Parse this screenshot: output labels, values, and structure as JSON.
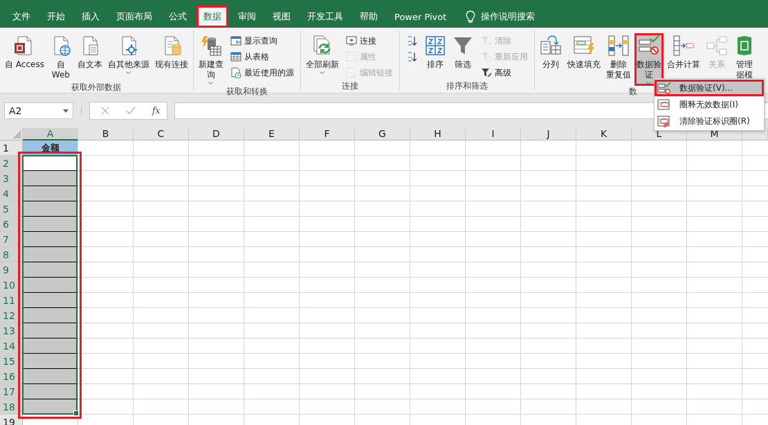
{
  "tabs": [
    {
      "label": "文件",
      "selected": false,
      "highlighted": false
    },
    {
      "label": "开始",
      "selected": false,
      "highlighted": false
    },
    {
      "label": "插入",
      "selected": false,
      "highlighted": false
    },
    {
      "label": "页面布局",
      "selected": false,
      "highlighted": false
    },
    {
      "label": "公式",
      "selected": false,
      "highlighted": false
    },
    {
      "label": "数据",
      "selected": true,
      "highlighted": true
    },
    {
      "label": "审阅",
      "selected": false,
      "highlighted": false
    },
    {
      "label": "视图",
      "selected": false,
      "highlighted": false
    },
    {
      "label": "开发工具",
      "selected": false,
      "highlighted": false
    },
    {
      "label": "帮助",
      "selected": false,
      "highlighted": false
    },
    {
      "label": "Power Pivot",
      "selected": false,
      "highlighted": false
    }
  ],
  "tell_me": "操作说明搜索",
  "ribbon": [
    {
      "label": "获取外部数据",
      "buttons": [
        {
          "kind": "large",
          "lines": [
            "自 Access"
          ],
          "disabled": false,
          "menu": false,
          "pressed": false,
          "highlighted": false
        },
        {
          "kind": "large",
          "lines": [
            "自",
            "Web"
          ],
          "disabled": false,
          "menu": false,
          "pressed": false,
          "highlighted": false
        },
        {
          "kind": "large",
          "lines": [
            "自文本"
          ],
          "disabled": false,
          "menu": false,
          "pressed": false,
          "highlighted": false
        },
        {
          "kind": "large",
          "lines": [
            "自其他来源"
          ],
          "disabled": false,
          "menu": true,
          "pressed": false,
          "highlighted": false
        },
        {
          "kind": "large",
          "lines": [
            "现有连接"
          ],
          "disabled": false,
          "menu": false,
          "pressed": false,
          "highlighted": false
        }
      ]
    },
    {
      "label": "获取和转换",
      "buttons": [
        {
          "kind": "large",
          "lines": [
            "新建查",
            "询"
          ],
          "disabled": false,
          "menu": true,
          "pressed": false,
          "highlighted": false
        },
        {
          "kind": "small",
          "lines": [
            "显示查询"
          ],
          "disabled": false,
          "menu": false,
          "pressed": false,
          "highlighted": false
        },
        {
          "kind": "small",
          "lines": [
            "从表格"
          ],
          "disabled": false,
          "menu": false,
          "pressed": false,
          "highlighted": false
        },
        {
          "kind": "small",
          "lines": [
            "最近使用的源"
          ],
          "disabled": false,
          "menu": false,
          "pressed": false,
          "highlighted": false
        }
      ]
    },
    {
      "label": "连接",
      "buttons": [
        {
          "kind": "large",
          "lines": [
            "全部刷新"
          ],
          "disabled": false,
          "menu": true,
          "pressed": false,
          "highlighted": false
        },
        {
          "kind": "small",
          "lines": [
            "连接"
          ],
          "disabled": false,
          "menu": false,
          "pressed": false,
          "highlighted": false
        },
        {
          "kind": "small",
          "lines": [
            "属性"
          ],
          "disabled": true,
          "menu": false,
          "pressed": false,
          "highlighted": false
        },
        {
          "kind": "small",
          "lines": [
            "编辑链接"
          ],
          "disabled": true,
          "menu": false,
          "pressed": false,
          "highlighted": false
        }
      ]
    },
    {
      "label": "排序和筛选",
      "buttons": [
        {
          "kind": "icon",
          "disabled": false,
          "menu": false,
          "pressed": false,
          "highlighted": false
        },
        {
          "kind": "icon",
          "disabled": false,
          "menu": false,
          "pressed": false,
          "highlighted": false
        },
        {
          "kind": "large",
          "lines": [
            "排序"
          ],
          "disabled": false,
          "menu": false,
          "pressed": false,
          "highlighted": false
        },
        {
          "kind": "large",
          "lines": [
            "筛选"
          ],
          "disabled": false,
          "menu": false,
          "pressed": false,
          "highlighted": false
        },
        {
          "kind": "small",
          "lines": [
            "清除"
          ],
          "disabled": true,
          "menu": false,
          "pressed": false,
          "highlighted": false
        },
        {
          "kind": "small",
          "lines": [
            "重新应用"
          ],
          "disabled": true,
          "menu": false,
          "pressed": false,
          "highlighted": false
        },
        {
          "kind": "small",
          "lines": [
            "高级"
          ],
          "disabled": false,
          "menu": false,
          "pressed": false,
          "highlighted": false
        }
      ]
    },
    {
      "label": "数",
      "buttons": [
        {
          "kind": "large",
          "lines": [
            "分列"
          ],
          "disabled": false,
          "menu": false,
          "pressed": false,
          "highlighted": false
        },
        {
          "kind": "large",
          "lines": [
            "快速填充"
          ],
          "disabled": false,
          "menu": false,
          "pressed": false,
          "highlighted": false
        },
        {
          "kind": "large",
          "lines": [
            "删除",
            "重复值"
          ],
          "disabled": false,
          "menu": false,
          "pressed": false,
          "highlighted": false
        },
        {
          "kind": "large",
          "lines": [
            "数据验",
            "证"
          ],
          "disabled": false,
          "menu": true,
          "pressed": true,
          "highlighted": true
        },
        {
          "kind": "large",
          "lines": [
            "合并计算"
          ],
          "disabled": false,
          "menu": false,
          "pressed": false,
          "highlighted": false
        },
        {
          "kind": "large",
          "lines": [
            "关系"
          ],
          "disabled": true,
          "menu": false,
          "pressed": false,
          "highlighted": false
        },
        {
          "kind": "large",
          "lines": [
            "管理",
            "据模"
          ],
          "disabled": false,
          "menu": false,
          "pressed": false,
          "highlighted": false
        }
      ]
    }
  ],
  "menu": [
    {
      "label": "数据验证(V)...",
      "selected": true,
      "highlighted": true
    },
    {
      "label": "圈释无效数据(I)",
      "selected": false,
      "highlighted": false
    },
    {
      "label": "清除验证标识圈(R)",
      "selected": false,
      "highlighted": false
    }
  ],
  "formula_bar": {
    "name_box": "A2",
    "fx": "fx"
  },
  "sheet": {
    "selection_highlighted": true,
    "columns": [
      {
        "label": "A",
        "selected": true
      },
      {
        "label": "B",
        "selected": false
      },
      {
        "label": "C",
        "selected": false
      },
      {
        "label": "D",
        "selected": false
      },
      {
        "label": "E",
        "selected": false
      },
      {
        "label": "F",
        "selected": false
      },
      {
        "label": "G",
        "selected": false
      },
      {
        "label": "H",
        "selected": false
      },
      {
        "label": "I",
        "selected": false
      },
      {
        "label": "J",
        "selected": false
      },
      {
        "label": "K",
        "selected": false
      },
      {
        "label": "L",
        "selected": false
      },
      {
        "label": "M",
        "selected": false
      }
    ],
    "rows": [
      {
        "label": "1",
        "selected": false,
        "cell_a": "金额"
      },
      {
        "label": "2",
        "selected": true
      },
      {
        "label": "3",
        "selected": true
      },
      {
        "label": "4",
        "selected": true
      },
      {
        "label": "5",
        "selected": true
      },
      {
        "label": "6",
        "selected": true
      },
      {
        "label": "7",
        "selected": true
      },
      {
        "label": "8",
        "selected": true
      },
      {
        "label": "9",
        "selected": true
      },
      {
        "label": "10",
        "selected": true
      },
      {
        "label": "11",
        "selected": true
      },
      {
        "label": "12",
        "selected": true
      },
      {
        "label": "13",
        "selected": true
      },
      {
        "label": "14",
        "selected": true
      },
      {
        "label": "15",
        "selected": true
      },
      {
        "label": "16",
        "selected": true
      },
      {
        "label": "17",
        "selected": true
      },
      {
        "label": "18",
        "selected": true
      },
      {
        "label": "19",
        "selected": false
      }
    ]
  }
}
